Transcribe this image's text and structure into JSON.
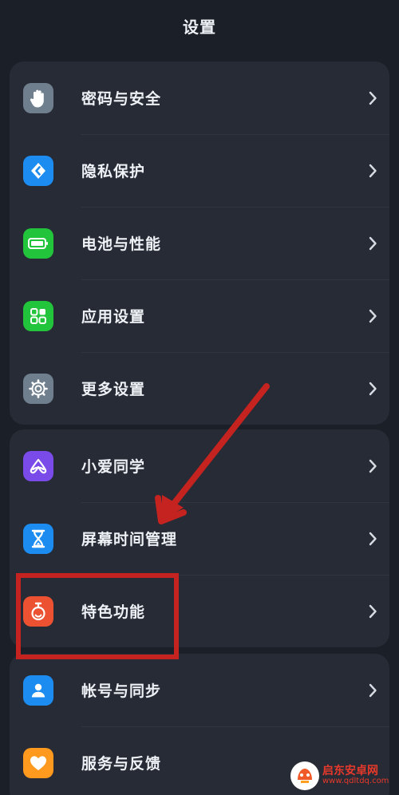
{
  "header": {
    "title": "设置"
  },
  "groups": [
    {
      "items": [
        {
          "label": "密码与安全",
          "icon": "hand-icon",
          "color": "#6f7f8e"
        },
        {
          "label": "隐私保护",
          "icon": "privacy-shield-icon",
          "color": "#1c8cf0"
        },
        {
          "label": "电池与性能",
          "icon": "battery-icon",
          "color": "#22c43b"
        },
        {
          "label": "应用设置",
          "icon": "apps-grid-icon",
          "color": "#22c43b"
        },
        {
          "label": "更多设置",
          "icon": "gear-icon",
          "color": "#6f7f8e"
        }
      ]
    },
    {
      "items": [
        {
          "label": "小爱同学",
          "icon": "xiaoai-icon",
          "color": "#7a4be8"
        },
        {
          "label": "屏幕时间管理",
          "icon": "hourglass-icon",
          "color": "#1c8cf0"
        },
        {
          "label": "特色功能",
          "icon": "stopwatch-icon",
          "color": "#ec5232"
        }
      ]
    },
    {
      "items": [
        {
          "label": "帐号与同步",
          "icon": "person-icon",
          "color": "#1c8cf0"
        },
        {
          "label": "服务与反馈",
          "icon": "heart-icon",
          "color": "#ff9a1f"
        }
      ]
    }
  ],
  "annotation": {
    "color": "#c4231f"
  },
  "watermark": {
    "name": "启东安卓网",
    "url": "www.qdltdq.com"
  }
}
